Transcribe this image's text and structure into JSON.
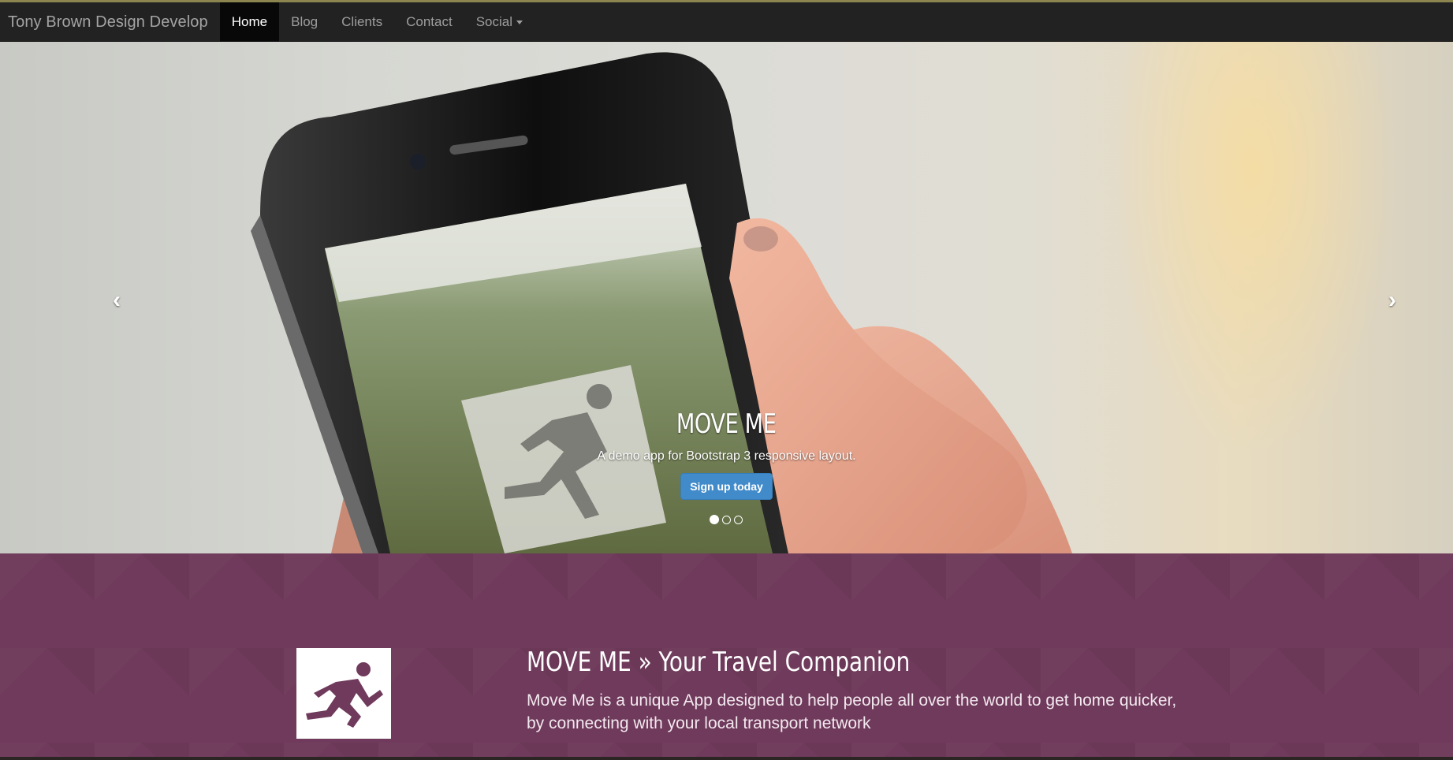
{
  "navbar": {
    "brand": "Tony Brown Design Develop",
    "items": [
      {
        "label": "Home",
        "active": true
      },
      {
        "label": "Blog"
      },
      {
        "label": "Clients"
      },
      {
        "label": "Contact"
      },
      {
        "label": "Social",
        "dropdown": true
      }
    ]
  },
  "carousel": {
    "title": "MOVE ME",
    "text": "A demo app for Bootstrap 3 responsive layout.",
    "button": "Sign up today",
    "slides": 3,
    "active_slide": 1,
    "prev_icon": "chevron-left-icon",
    "next_icon": "chevron-right-icon"
  },
  "feature": {
    "title": "MOVE ME » Your Travel Companion",
    "text": "Move Me is a unique App designed to help people all over the world to get home quicker, by connecting with your local transport network",
    "logo_icon": "running-man-icon"
  },
  "colors": {
    "navbar": "#222222",
    "accent_purple": "#6f3a5b",
    "button_blue": "#428bca"
  }
}
